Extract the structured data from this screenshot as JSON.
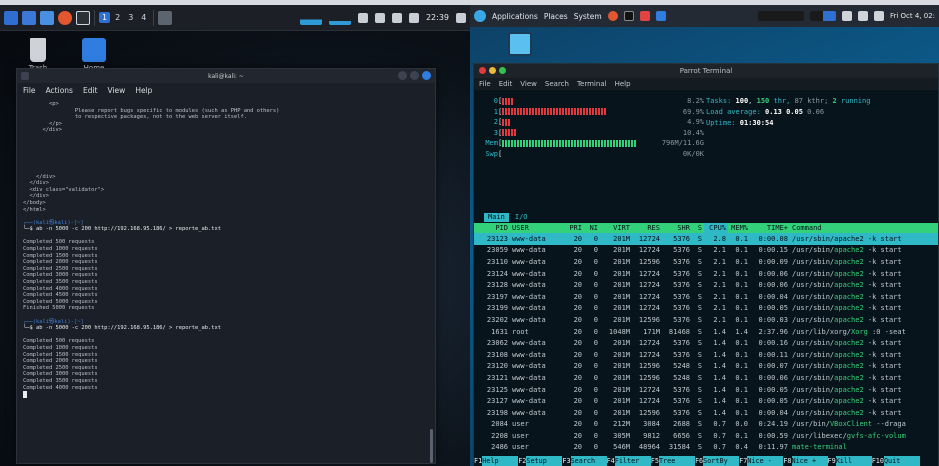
{
  "left": {
    "panel": {
      "workspaces": [
        "1",
        "2",
        "3",
        "4"
      ],
      "active_workspace": "1",
      "clock": "22:39"
    },
    "desktop_icons": [
      {
        "label": "Trash"
      },
      {
        "label": "Home"
      }
    ],
    "terminal": {
      "title": "kali@kali: ~",
      "menu": [
        "File",
        "Actions",
        "Edit",
        "View",
        "Help"
      ],
      "lines": [
        {
          "text": "        <p>",
          "kind": "out"
        },
        {
          "text": "                Please report bugs specific to modules (such as PHP and others)",
          "kind": "out"
        },
        {
          "text": "                to respective packages, not to the web server itself.",
          "kind": "out"
        },
        {
          "text": "        </p>",
          "kind": "out"
        },
        {
          "text": "      </div>",
          "kind": "out"
        },
        {
          "text": "",
          "kind": "out"
        },
        {
          "text": "",
          "kind": "out"
        },
        {
          "text": "",
          "kind": "out"
        },
        {
          "text": "",
          "kind": "out"
        },
        {
          "text": "",
          "kind": "out"
        },
        {
          "text": "",
          "kind": "out"
        },
        {
          "text": "    </div>",
          "kind": "out"
        },
        {
          "text": "  </div>",
          "kind": "out"
        },
        {
          "text": "  <div class=\"validator\">",
          "kind": "out"
        },
        {
          "text": "  </div>",
          "kind": "out"
        },
        {
          "text": "</body>",
          "kind": "out"
        },
        {
          "text": "</html>",
          "kind": "out"
        },
        {
          "text": "",
          "kind": "out"
        },
        {
          "text": "┌──(kali㉿kali)-[~]",
          "kind": "prompt"
        },
        {
          "text": "└─$ ab -n 5000 -c 200 http://192.168.95.186/ > reporte_ab.txt",
          "kind": "cmd"
        },
        {
          "text": "",
          "kind": "out"
        },
        {
          "text": "Completed 500 requests",
          "kind": "out"
        },
        {
          "text": "Completed 1000 requests",
          "kind": "out"
        },
        {
          "text": "Completed 1500 requests",
          "kind": "out"
        },
        {
          "text": "Completed 2000 requests",
          "kind": "out"
        },
        {
          "text": "Completed 2500 requests",
          "kind": "out"
        },
        {
          "text": "Completed 3000 requests",
          "kind": "out"
        },
        {
          "text": "Completed 3500 requests",
          "kind": "out"
        },
        {
          "text": "Completed 4000 requests",
          "kind": "out"
        },
        {
          "text": "Completed 4500 requests",
          "kind": "out"
        },
        {
          "text": "Completed 5000 requests",
          "kind": "out"
        },
        {
          "text": "Finished 5000 requests",
          "kind": "out"
        },
        {
          "text": "",
          "kind": "out"
        },
        {
          "text": "┌──(kali㉿kali)-[~]",
          "kind": "prompt"
        },
        {
          "text": "└─$ ab -n 5000 -c 200 http://192.168.95.186/ > reporte_ab.txt",
          "kind": "cmd"
        },
        {
          "text": "",
          "kind": "out"
        },
        {
          "text": "Completed 500 requests",
          "kind": "out"
        },
        {
          "text": "Completed 1000 requests",
          "kind": "out"
        },
        {
          "text": "Completed 1500 requests",
          "kind": "out"
        },
        {
          "text": "Completed 2000 requests",
          "kind": "out"
        },
        {
          "text": "Completed 2500 requests",
          "kind": "out"
        },
        {
          "text": "Completed 3000 requests",
          "kind": "out"
        },
        {
          "text": "Completed 3500 requests",
          "kind": "out"
        },
        {
          "text": "Completed 4000 requests",
          "kind": "out"
        }
      ]
    }
  },
  "right": {
    "panel": {
      "menu": [
        "Applications",
        "Places",
        "System"
      ],
      "clock": "Fri Oct 4, 02:"
    },
    "terminal": {
      "title": "Parrot Terminal",
      "menu": [
        "File",
        "Edit",
        "View",
        "Search",
        "Terminal",
        "Help"
      ],
      "meters": [
        {
          "label": "0",
          "value": "8.2%",
          "fraction": 0.08
        },
        {
          "label": "1",
          "value": "69.9%",
          "fraction": 0.7
        },
        {
          "label": "2",
          "value": "4.9%",
          "fraction": 0.05
        },
        {
          "label": "3",
          "value": "10.4%",
          "fraction": 0.1
        },
        {
          "label": "Mem",
          "value": "796M/11.6G",
          "fraction": 0.9
        },
        {
          "label": "Swp",
          "value": "0K/0K",
          "fraction": 0
        }
      ],
      "tasks": {
        "label": "Tasks:",
        "count": "100",
        "threads": "150",
        "thr_label": "thr,",
        "kthr": "87",
        "kthr_label": "kthr;",
        "running": "2",
        "running_label": "running"
      },
      "load": {
        "label": "Load average:",
        "v1": "0.13",
        "v5": "0.05",
        "v15": "0.06"
      },
      "uptime": {
        "label": "Uptime:",
        "value": "01:30:54"
      },
      "tabs": [
        "Main",
        "I/O"
      ],
      "columns": [
        "PID",
        "USER",
        "PRI",
        "NI",
        "VIRT",
        "RES",
        "SHR",
        "S",
        "CPU%",
        "MEM%",
        "TIME+",
        "Command"
      ],
      "processes": [
        {
          "pid": "23123",
          "user": "www-data",
          "pri": "20",
          "ni": "0",
          "virt": "201M",
          "res": "12724",
          "shr": "5376",
          "s": "S",
          "cpu": "2.8",
          "mem": "0.1",
          "time": "0:00.08",
          "cmd_path": "/usr/sbin/",
          "cmd_bin": "apache2",
          "cmd_args": " -k start",
          "selected": true
        },
        {
          "pid": "23059",
          "user": "www-data",
          "pri": "20",
          "ni": "0",
          "virt": "201M",
          "res": "12724",
          "shr": "5376",
          "s": "S",
          "cpu": "2.1",
          "mem": "0.1",
          "time": "0:00.15",
          "cmd_path": "/usr/sbin/",
          "cmd_bin": "apache2",
          "cmd_args": " -k start"
        },
        {
          "pid": "23110",
          "user": "www-data",
          "pri": "20",
          "ni": "0",
          "virt": "201M",
          "res": "12596",
          "shr": "5376",
          "s": "S",
          "cpu": "2.1",
          "mem": "0.1",
          "time": "0:00.09",
          "cmd_path": "/usr/sbin/",
          "cmd_bin": "apache2",
          "cmd_args": " -k start"
        },
        {
          "pid": "23124",
          "user": "www-data",
          "pri": "20",
          "ni": "0",
          "virt": "201M",
          "res": "12724",
          "shr": "5376",
          "s": "S",
          "cpu": "2.1",
          "mem": "0.1",
          "time": "0:00.06",
          "cmd_path": "/usr/sbin/",
          "cmd_bin": "apache2",
          "cmd_args": " -k start"
        },
        {
          "pid": "23128",
          "user": "www-data",
          "pri": "20",
          "ni": "0",
          "virt": "201M",
          "res": "12724",
          "shr": "5376",
          "s": "S",
          "cpu": "2.1",
          "mem": "0.1",
          "time": "0:00.06",
          "cmd_path": "/usr/sbin/",
          "cmd_bin": "apache2",
          "cmd_args": " -k start"
        },
        {
          "pid": "23197",
          "user": "www-data",
          "pri": "20",
          "ni": "0",
          "virt": "201M",
          "res": "12724",
          "shr": "5376",
          "s": "S",
          "cpu": "2.1",
          "mem": "0.1",
          "time": "0:00.04",
          "cmd_path": "/usr/sbin/",
          "cmd_bin": "apache2",
          "cmd_args": " -k start"
        },
        {
          "pid": "23199",
          "user": "www-data",
          "pri": "20",
          "ni": "0",
          "virt": "201M",
          "res": "12724",
          "shr": "5376",
          "s": "S",
          "cpu": "2.1",
          "mem": "0.1",
          "time": "0:00.05",
          "cmd_path": "/usr/sbin/",
          "cmd_bin": "apache2",
          "cmd_args": " -k start"
        },
        {
          "pid": "23202",
          "user": "www-data",
          "pri": "20",
          "ni": "0",
          "virt": "201M",
          "res": "12596",
          "shr": "5376",
          "s": "S",
          "cpu": "2.1",
          "mem": "0.1",
          "time": "0:00.03",
          "cmd_path": "/usr/sbin/",
          "cmd_bin": "apache2",
          "cmd_args": " -k start"
        },
        {
          "pid": "1631",
          "user": "root",
          "pri": "20",
          "ni": "0",
          "virt": "1048M",
          "res": "171M",
          "shr": "81468",
          "s": "S",
          "cpu": "1.4",
          "mem": "1.4",
          "time": "2:37.96",
          "cmd_path": "/usr/lib/xorg/",
          "cmd_bin": "Xorg",
          "cmd_args": " :0 -seat"
        },
        {
          "pid": "23062",
          "user": "www-data",
          "pri": "20",
          "ni": "0",
          "virt": "201M",
          "res": "12724",
          "shr": "5376",
          "s": "S",
          "cpu": "1.4",
          "mem": "0.1",
          "time": "0:00.16",
          "cmd_path": "/usr/sbin/",
          "cmd_bin": "apache2",
          "cmd_args": " -k start"
        },
        {
          "pid": "23108",
          "user": "www-data",
          "pri": "20",
          "ni": "0",
          "virt": "201M",
          "res": "12724",
          "shr": "5376",
          "s": "S",
          "cpu": "1.4",
          "mem": "0.1",
          "time": "0:00.11",
          "cmd_path": "/usr/sbin/",
          "cmd_bin": "apache2",
          "cmd_args": " -k start"
        },
        {
          "pid": "23120",
          "user": "www-data",
          "pri": "20",
          "ni": "0",
          "virt": "201M",
          "res": "12596",
          "shr": "5248",
          "s": "S",
          "cpu": "1.4",
          "mem": "0.1",
          "time": "0:00.07",
          "cmd_path": "/usr/sbin/",
          "cmd_bin": "apache2",
          "cmd_args": " -k start"
        },
        {
          "pid": "23121",
          "user": "www-data",
          "pri": "20",
          "ni": "0",
          "virt": "201M",
          "res": "12596",
          "shr": "5248",
          "s": "S",
          "cpu": "1.4",
          "mem": "0.1",
          "time": "0:00.06",
          "cmd_path": "/usr/sbin/",
          "cmd_bin": "apache2",
          "cmd_args": " -k start"
        },
        {
          "pid": "23125",
          "user": "www-data",
          "pri": "20",
          "ni": "0",
          "virt": "201M",
          "res": "12724",
          "shr": "5376",
          "s": "S",
          "cpu": "1.4",
          "mem": "0.1",
          "time": "0:00.05",
          "cmd_path": "/usr/sbin/",
          "cmd_bin": "apache2",
          "cmd_args": " -k start"
        },
        {
          "pid": "23127",
          "user": "www-data",
          "pri": "20",
          "ni": "0",
          "virt": "201M",
          "res": "12724",
          "shr": "5376",
          "s": "S",
          "cpu": "1.4",
          "mem": "0.1",
          "time": "0:00.05",
          "cmd_path": "/usr/sbin/",
          "cmd_bin": "apache2",
          "cmd_args": " -k start"
        },
        {
          "pid": "23198",
          "user": "www-data",
          "pri": "20",
          "ni": "0",
          "virt": "201M",
          "res": "12596",
          "shr": "5376",
          "s": "S",
          "cpu": "1.4",
          "mem": "0.1",
          "time": "0:00.04",
          "cmd_path": "/usr/sbin/",
          "cmd_bin": "apache2",
          "cmd_args": " -k start"
        },
        {
          "pid": "2084",
          "user": "user",
          "pri": "20",
          "ni": "0",
          "virt": "212M",
          "res": "3084",
          "shr": "2688",
          "s": "S",
          "cpu": "0.7",
          "mem": "0.0",
          "time": "0:24.19",
          "cmd_path": "/usr/bin/",
          "cmd_bin": "VBoxClient",
          "cmd_args": " --draga"
        },
        {
          "pid": "2208",
          "user": "user",
          "pri": "20",
          "ni": "0",
          "virt": "305M",
          "res": "9812",
          "shr": "6656",
          "s": "S",
          "cpu": "0.7",
          "mem": "0.1",
          "time": "0:00.59",
          "cmd_path": "/usr/libexec/",
          "cmd_bin": "gvfs-afc-volum",
          "cmd_args": ""
        },
        {
          "pid": "2486",
          "user": "user",
          "pri": "20",
          "ni": "0",
          "virt": "546M",
          "res": "48964",
          "shr": "31584",
          "s": "S",
          "cpu": "0.7",
          "mem": "0.4",
          "time": "0:11.97",
          "cmd_path": "",
          "cmd_bin": "mate-terminal",
          "cmd_args": ""
        }
      ],
      "fkeys": [
        {
          "key": "F1",
          "label": "Help"
        },
        {
          "key": "F2",
          "label": "Setup"
        },
        {
          "key": "F3",
          "label": "Search"
        },
        {
          "key": "F4",
          "label": "Filter"
        },
        {
          "key": "F5",
          "label": "Tree"
        },
        {
          "key": "F6",
          "label": "SortBy"
        },
        {
          "key": "F7",
          "label": "Nice -"
        },
        {
          "key": "F8",
          "label": "Nice +"
        },
        {
          "key": "F9",
          "label": "Kill"
        },
        {
          "key": "F10",
          "label": "Quit"
        }
      ]
    }
  },
  "colors": {
    "kali_accent": "#2e6fd1",
    "htop_cyan": "#2fb8c6",
    "htop_green": "#33d17a",
    "htop_red": "#e0393e"
  }
}
